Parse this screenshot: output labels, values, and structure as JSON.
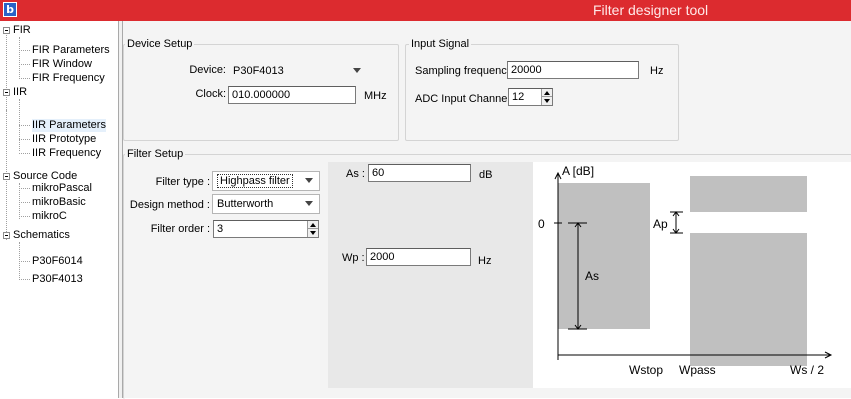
{
  "window": {
    "title": "Filter designer tool",
    "app_icon": "b"
  },
  "tree": {
    "sections": [
      {
        "label": "FIR",
        "children": [
          "FIR Parameters",
          "FIR Window",
          "FIR Frequency"
        ]
      },
      {
        "label": "IIR",
        "children": [
          "IIR Parameters",
          "IIR Prototype",
          "IIR Frequency"
        ]
      },
      {
        "label": "Source Code",
        "children": [
          "mikroPascal",
          "mikroBasic",
          "mikroC"
        ]
      },
      {
        "label": "Schematics",
        "children": [
          "P30F6014",
          "P30F4013"
        ]
      }
    ]
  },
  "device_setup": {
    "title": "Device Setup",
    "device_label": "Device:",
    "device_value": "P30F4013",
    "clock_label": "Clock:",
    "clock_value": "010.000000",
    "clock_unit": "MHz"
  },
  "input_signal": {
    "title": "Input Signal",
    "sampling_label": "Sampling frequency:",
    "sampling_value": "20000",
    "sampling_unit": "Hz",
    "adc_label": "ADC Input Channel:",
    "adc_value": "12"
  },
  "filter_setup": {
    "title": "Filter Setup",
    "type_label": "Filter type :",
    "type_value": "Highpass filter",
    "method_label": "Design method :",
    "method_value": "Butterworth",
    "order_label": "Filter order :",
    "order_value": "3",
    "as_label": "As :",
    "as_value": "60",
    "as_unit": "dB",
    "wp_label": "Wp :",
    "wp_value": "2000",
    "wp_unit": "Hz"
  },
  "diagram": {
    "y_axis_label": "A [dB]",
    "zero_label": "0",
    "ap_label": "Ap",
    "as_label": "As",
    "x_labels": [
      "Wstop",
      "Wpass",
      "Ws / 2"
    ],
    "colors": {
      "band": "#c0c0c0",
      "title_bar": "#dc2b2f",
      "selected_item": "#e5f0fb"
    }
  }
}
